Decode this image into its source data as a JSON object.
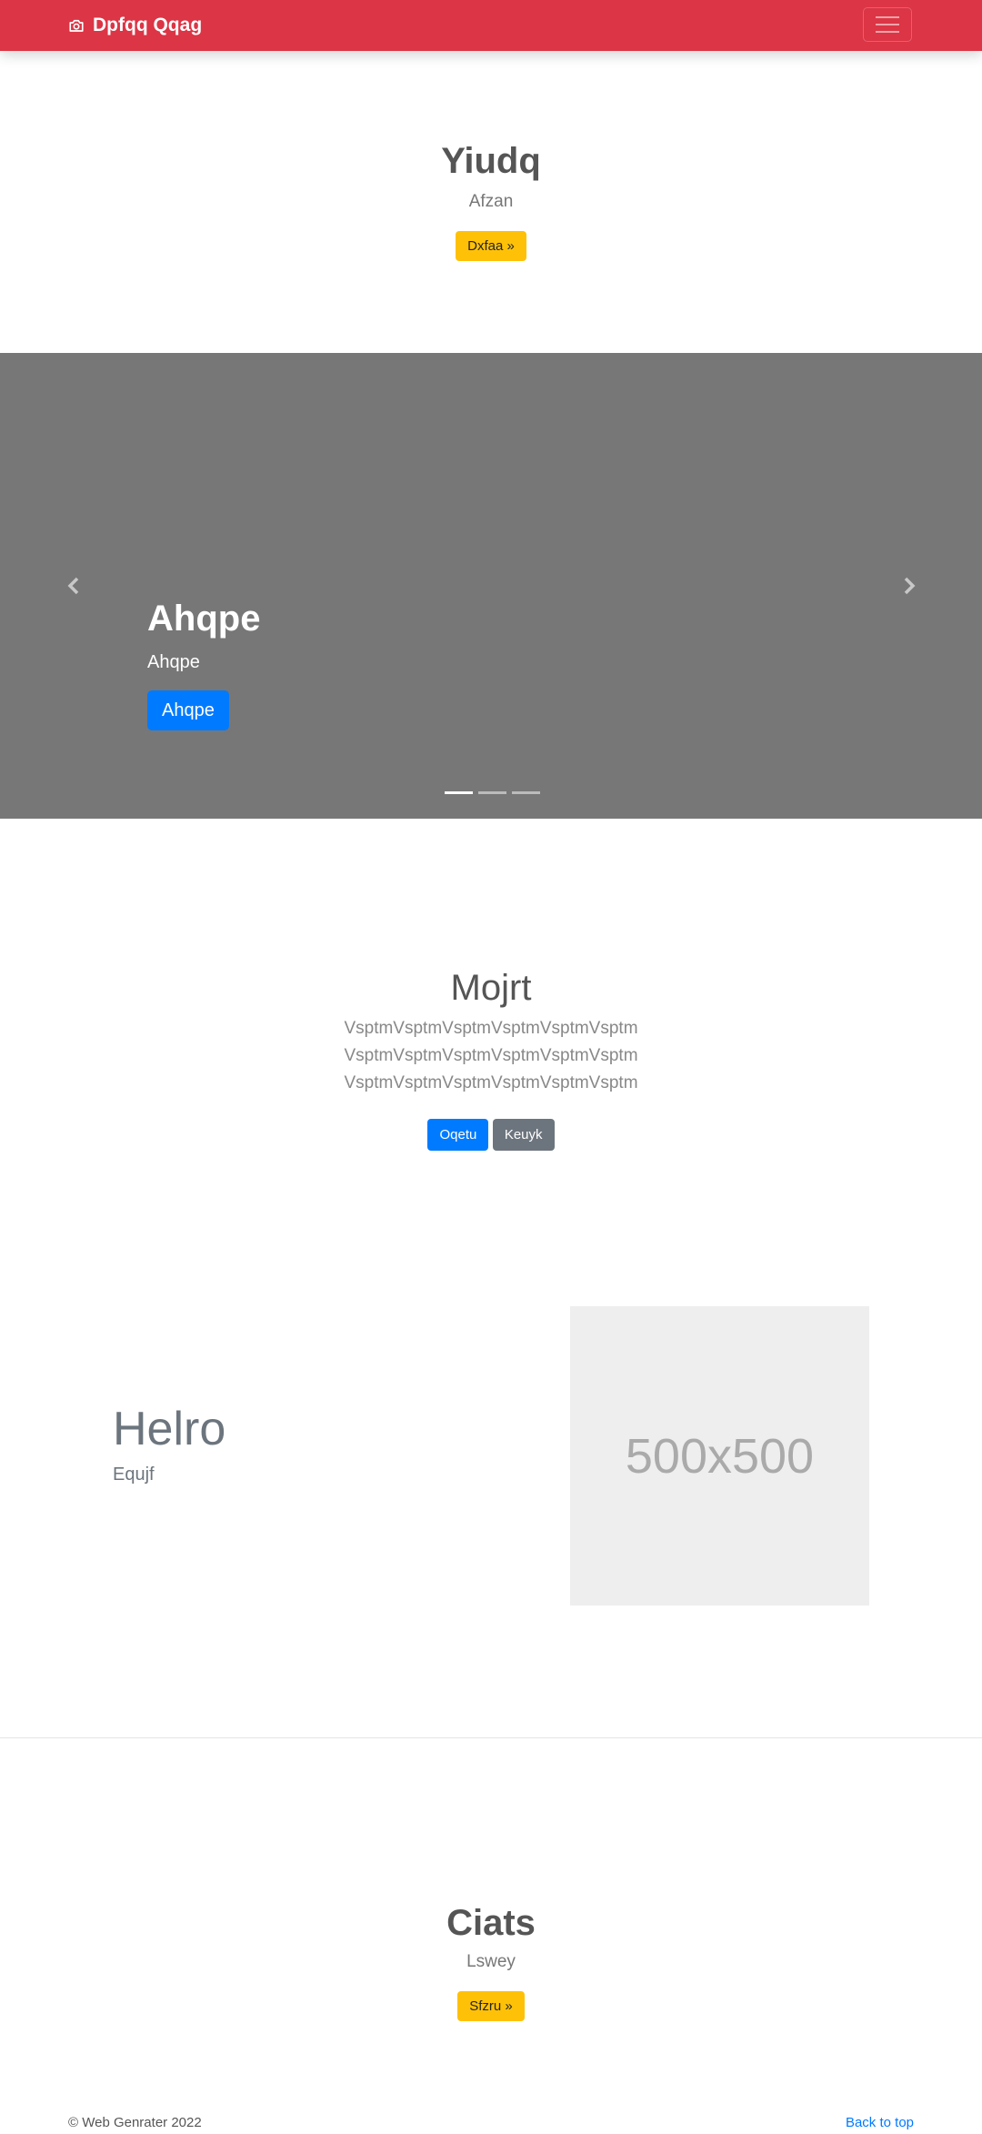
{
  "navbar": {
    "brand": "Dpfqq Qqag",
    "brand_icon": "camera-icon",
    "toggler_icon": "hamburger-icon",
    "color": "#dc3545"
  },
  "hero": {
    "title": "Yiudq",
    "subtitle": "Afzan",
    "button": "Dxfaa »"
  },
  "carousel": {
    "title": "Ahqpe",
    "text": "Ahqpe",
    "button": "Ahqpe",
    "slides": 3,
    "active_slide": 1,
    "prev_icon": "chevron-left-icon",
    "next_icon": "chevron-right-icon"
  },
  "intro": {
    "title": "Mojrt",
    "lines": [
      "VsptmVsptmVsptmVsptmVsptmVsptm",
      "VsptmVsptmVsptmVsptmVsptmVsptm",
      "VsptmVsptmVsptmVsptmVsptmVsptm"
    ],
    "primary_button": "Oqetu",
    "secondary_button": "Keuyk"
  },
  "feature": {
    "title": "Helro",
    "subtitle": "Equjf",
    "image_label": "500x500"
  },
  "cta": {
    "title": "Ciats",
    "subtitle": "Lswey",
    "button": "Sfzru »"
  },
  "footer": {
    "copyright": "© Web Genrater 2022",
    "back_to_top": "Back to top"
  }
}
